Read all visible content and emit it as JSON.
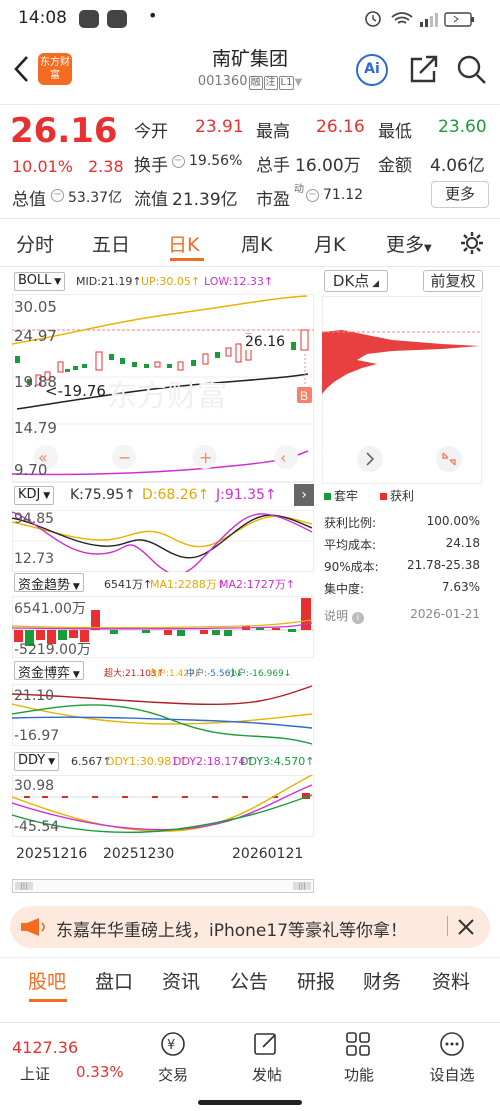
{
  "status_bar": {
    "time": "14:08",
    "dot": "•"
  },
  "header": {
    "title": "南矿集团",
    "code": "001360",
    "tags": [
      "融",
      "注",
      "L1"
    ],
    "logo_text": "东方财富",
    "ai_label": "Ai"
  },
  "quote": {
    "price": "26.16",
    "change_pct": "10.01%",
    "change": "2.38",
    "open_label": "今开",
    "open": "23.91",
    "high_label": "最高",
    "high": "26.16",
    "low_label": "最低",
    "low": "23.60",
    "turnover_label": "换手",
    "turnover": "19.56%",
    "volume_label": "总手",
    "volume": "16.00万",
    "amount_label": "金额",
    "amount": "4.06亿",
    "mktcap_label": "总值",
    "mktcap": "53.37亿",
    "float_label": "流值",
    "float": "21.39亿",
    "pe_label": "市盈",
    "pe_sup": "动",
    "pe": "71.12",
    "more_label": "更多"
  },
  "kline_tabs": [
    "分时",
    "五日",
    "日K",
    "周K",
    "月K",
    "更多"
  ],
  "active_tab": "日K",
  "boll": {
    "name": "BOLL",
    "mid": "MID:21.19↑",
    "up": "UP:30.05↑",
    "low": "LOW:12.33↑",
    "y_labels": [
      "30.05",
      "24.97",
      "19.88",
      "14.79",
      "9.70"
    ],
    "price_marker": "26.16",
    "low_marker": "<-19.76",
    "b_badge": "B",
    "watermark": "东方财富"
  },
  "dk_panel": {
    "dk_label": "DK点",
    "adjust_label": "前复权",
    "legend_trapped": "套牢",
    "legend_profit": "获利",
    "rows": [
      {
        "label": "获利比例:",
        "value": "100.00%"
      },
      {
        "label": "平均成本:",
        "value": "24.18"
      },
      {
        "label": "90%成本:",
        "value": "21.78-25.38"
      },
      {
        "label": "集中度:",
        "value": "7.63%"
      }
    ],
    "note_label": "说明",
    "date": "2026-01-21"
  },
  "kdj": {
    "name": "KDJ",
    "k": "K:75.95↑",
    "d": "D:68.26↑",
    "j": "J:91.35↑",
    "y_top": "94.85",
    "y_bottom": "12.73"
  },
  "fund_trend": {
    "name": "资金趋势",
    "v": "6541万↑",
    "ma1": "MA1:2288万↑",
    "ma2": "MA2:1727万↑",
    "y_top": "6541.00万",
    "y_bottom": "-5219.00万"
  },
  "fund_game": {
    "name": "资金博弈",
    "super": "超大:21.103↑",
    "big": "大户:1.427↓",
    "mid": "中户:-5.561↓",
    "small": "小户:-16.969↓",
    "y_top": "21.10",
    "y_bottom": "-16.97"
  },
  "ddy": {
    "name": "DDY",
    "v": "6.567↑",
    "ddy1": "DDY1:30.981↑",
    "ddy2": "DDY2:18.174↑",
    "ddy3": "DDY3:4.570↑",
    "y_top": "30.98",
    "y_bottom": "-45.54"
  },
  "dates": [
    "20251216",
    "20251230",
    "20260121"
  ],
  "banner": {
    "text": "东嘉年华重磅上线，iPhone17等豪礼等你拿！"
  },
  "bottom_tabs": [
    "股吧",
    "盘口",
    "资讯",
    "公告",
    "研报",
    "财务",
    "资料"
  ],
  "active_bottom_tab": "股吧",
  "bottom_nav": {
    "index_value": "4127.36",
    "index_name": "上证",
    "index_change": "0.33%",
    "items": [
      "交易",
      "发帖",
      "功能",
      "设自选"
    ]
  },
  "colors": {
    "up": "#e93030",
    "down": "#1a9b3a",
    "accent": "#f36c21"
  }
}
